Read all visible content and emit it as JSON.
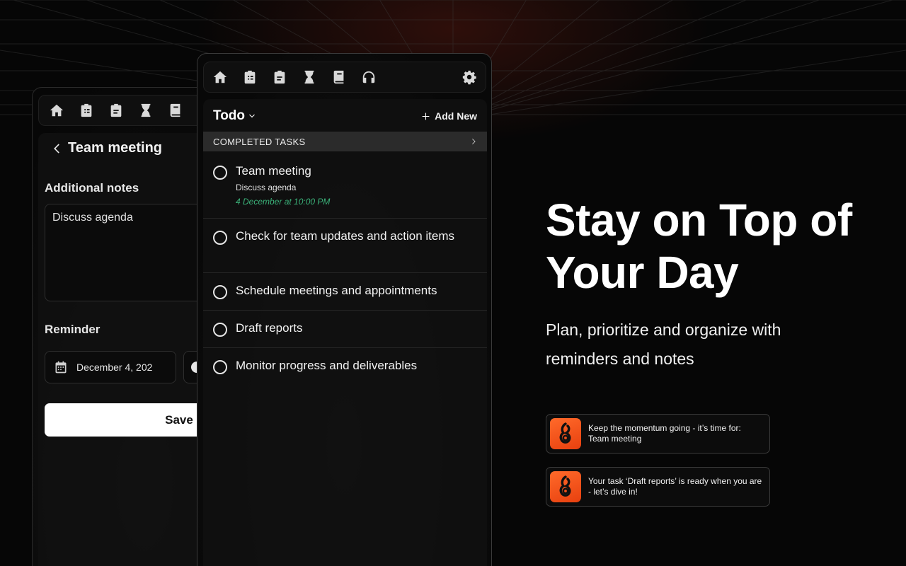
{
  "back_window": {
    "toolbar_icons": [
      "home-icon",
      "clipboard-list-icon",
      "clipboard-icon",
      "hourglass-icon",
      "book-icon"
    ],
    "title": "Team meeting",
    "notes_label": "Additional notes",
    "notes_value": "Discuss agenda",
    "reminder_label": "Reminder",
    "reminder_date": "December 4, 202",
    "save_label": "Save"
  },
  "front_window": {
    "toolbar_icons": [
      "home-icon",
      "clipboard-list-icon",
      "clipboard-icon",
      "hourglass-icon",
      "book-icon",
      "headphones-icon",
      "gear-icon"
    ],
    "list_title": "Todo",
    "add_new_label": "Add New",
    "completed_label": "COMPLETED TASKS",
    "tasks": [
      {
        "title": "Team meeting",
        "note": "Discuss agenda",
        "due": "4 December at 10:00 PM"
      },
      {
        "title": "Check for team updates and action items"
      },
      {
        "title": "Schedule meetings and appointments"
      },
      {
        "title": "Draft reports"
      },
      {
        "title": "Monitor progress and deliverables"
      }
    ]
  },
  "promo": {
    "headline": "Stay on Top of Your Day",
    "subheadline": "Plan, prioritize and organize with reminders and notes",
    "notifications": [
      {
        "text": "Keep the momentum going - it’s time for: Team meeting",
        "icon": "app-logo-icon"
      },
      {
        "text": "Your task ‘Draft reports’ is ready when you are - let’s dive in!",
        "icon": "app-logo-icon"
      }
    ]
  },
  "colors": {
    "accent_orange": "#f25a1c",
    "due_date_green": "#3bb37a",
    "background": "#060606"
  }
}
